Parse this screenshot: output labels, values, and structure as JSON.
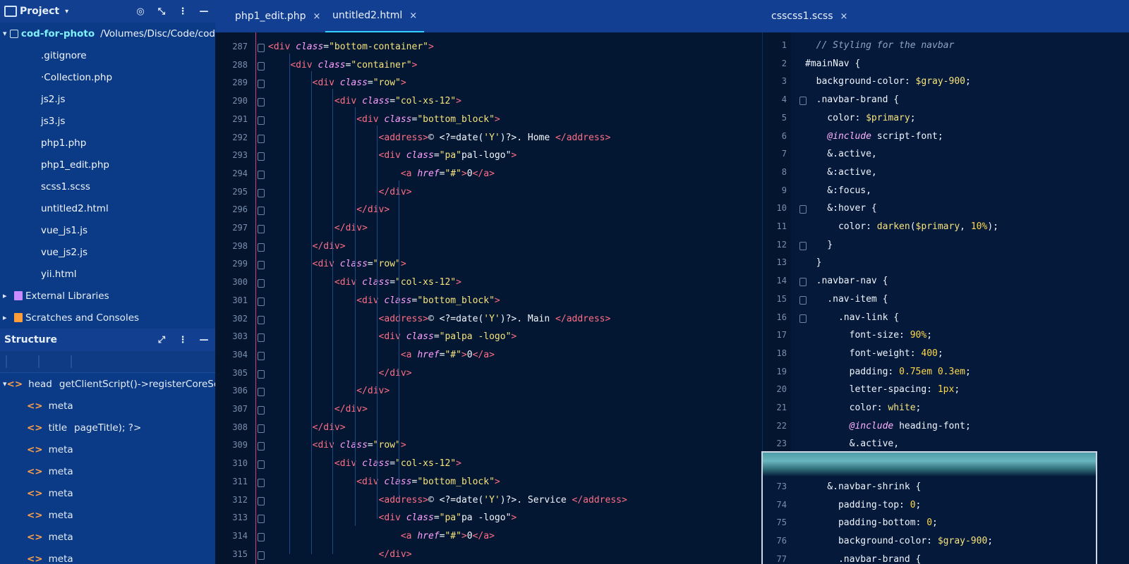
{
  "sidebar": {
    "project_title": "Project",
    "project": {
      "name": "cod-for-photo",
      "path": "/Volumes/Disc/Code/cod"
    },
    "files": [
      ".gitignore",
      "·Collection.php",
      "js2.js",
      "js3.js",
      "php1.php",
      "php1_edit.php",
      "scss1.scss",
      "untitled2.html",
      "vue_js1.js",
      "vue_js2.js",
      "yii.html"
    ],
    "external_libraries": "External Libraries",
    "scratches": "Scratches and Consoles",
    "structure_title": "Structure",
    "structure": {
      "root_tag": "<>",
      "root_label": "head",
      "root_extra": "getClientScript()->registerCoreScrip",
      "children": [
        {
          "label": "meta",
          "extra": ""
        },
        {
          "label": "title",
          "extra": "pageTitle); ?>"
        },
        {
          "label": "meta",
          "extra": ""
        },
        {
          "label": "meta",
          "extra": ""
        },
        {
          "label": "meta",
          "extra": ""
        },
        {
          "label": "meta",
          "extra": ""
        },
        {
          "label": "meta",
          "extra": ""
        },
        {
          "label": "meta",
          "extra": ""
        }
      ]
    }
  },
  "tabs": [
    {
      "label": "php1_edit.php",
      "close": "×"
    },
    {
      "label": "untitled2.html",
      "close": "×"
    },
    {
      "label": "csscss1.scss",
      "close": "×"
    }
  ],
  "left_editor": {
    "lines": [
      {
        "n": "287",
        "t": "<div class=\"bottom-container\">"
      },
      {
        "n": "288",
        "t": "    <div class=\"container\">"
      },
      {
        "n": "289",
        "t": "        <div class=\"row\">"
      },
      {
        "n": "290",
        "t": "            <div class=\"col-xs-12\">"
      },
      {
        "n": "291",
        "t": "                <div class=\"bottom_block\">"
      },
      {
        "n": "292",
        "t": "                    <address>© <?=date('Y')?>. Home </address>"
      },
      {
        "n": "293",
        "t": "                    <div class=\"pa\"pal-logo\">"
      },
      {
        "n": "294",
        "t": "                        <a href=\"#\">0</a>"
      },
      {
        "n": "295",
        "t": "                    </div>"
      },
      {
        "n": "296",
        "t": "                </div>"
      },
      {
        "n": "297",
        "t": "            </div>"
      },
      {
        "n": "298",
        "t": "        </div>"
      },
      {
        "n": "299",
        "t": "        <div class=\"row\">"
      },
      {
        "n": "300",
        "t": "            <div class=\"col-xs-12\">"
      },
      {
        "n": "301",
        "t": "                <div class=\"bottom_block\">"
      },
      {
        "n": "302",
        "t": "                    <address>© <?=date('Y')?>. Main </address>"
      },
      {
        "n": "303",
        "t": "                    <div class=\"palpa -logo\">"
      },
      {
        "n": "304",
        "t": "                        <a href=\"#\">0</a>"
      },
      {
        "n": "305",
        "t": "                    </div>"
      },
      {
        "n": "306",
        "t": "                </div>"
      },
      {
        "n": "307",
        "t": "            </div>"
      },
      {
        "n": "308",
        "t": "        </div>"
      },
      {
        "n": "309",
        "t": "        <div class=\"row\">"
      },
      {
        "n": "310",
        "t": "            <div class=\"col-xs-12\">"
      },
      {
        "n": "311",
        "t": "                <div class=\"bottom_block\">"
      },
      {
        "n": "312",
        "t": "                    <address>© <?=date('Y')?>. Service </address>"
      },
      {
        "n": "313",
        "t": "                    <div class=\"pa\"pa -logo\">"
      },
      {
        "n": "314",
        "t": "                        <a href=\"#\">0</a>"
      },
      {
        "n": "315",
        "t": "                    </div>"
      }
    ]
  },
  "right_editor": {
    "lines": [
      {
        "n": "1",
        "t": "  // Styling for the navbar"
      },
      {
        "n": "2",
        "t": "#mainNav {"
      },
      {
        "n": "3",
        "t": "  background-color: $gray-900;"
      },
      {
        "n": "4",
        "t": "  .navbar-brand {"
      },
      {
        "n": "5",
        "t": "    color: $primary;"
      },
      {
        "n": "6",
        "t": "    @include script-font;"
      },
      {
        "n": "7",
        "t": "    &.active,"
      },
      {
        "n": "8",
        "t": "    &:active,"
      },
      {
        "n": "9",
        "t": "    &:focus,"
      },
      {
        "n": "10",
        "t": "    &:hover {"
      },
      {
        "n": "11",
        "t": "      color: darken($primary, 10%);"
      },
      {
        "n": "12",
        "t": "    }"
      },
      {
        "n": "13",
        "t": "  }"
      },
      {
        "n": "14",
        "t": "  .navbar-nav {"
      },
      {
        "n": "15",
        "t": "    .nav-item {"
      },
      {
        "n": "16",
        "t": "      .nav-link {"
      },
      {
        "n": "17",
        "t": "        font-size: 90%;"
      },
      {
        "n": "18",
        "t": "        font-weight: 400;"
      },
      {
        "n": "19",
        "t": "        padding: 0.75em 0.3em;"
      },
      {
        "n": "20",
        "t": "        letter-spacing: 1px;"
      },
      {
        "n": "21",
        "t": "        color: white;"
      },
      {
        "n": "22",
        "t": "        @include heading-font;"
      },
      {
        "n": "23",
        "t": "        &.active,"
      }
    ],
    "lines_lower": [
      {
        "n": "73",
        "t": "    &.navbar-shrink {"
      },
      {
        "n": "74",
        "t": "      padding-top: 0;"
      },
      {
        "n": "75",
        "t": "      padding-bottom: 0;"
      },
      {
        "n": "76",
        "t": "      background-color: $gray-900;"
      },
      {
        "n": "77",
        "t": "      .navbar-brand {"
      }
    ]
  },
  "colors": {
    "sidebar": "#0b3a86",
    "editor": "#041732",
    "tag": "#ff6e86",
    "attr": "#ffa0ff",
    "string": "#f7e37c",
    "accent": "#35d0ff"
  }
}
